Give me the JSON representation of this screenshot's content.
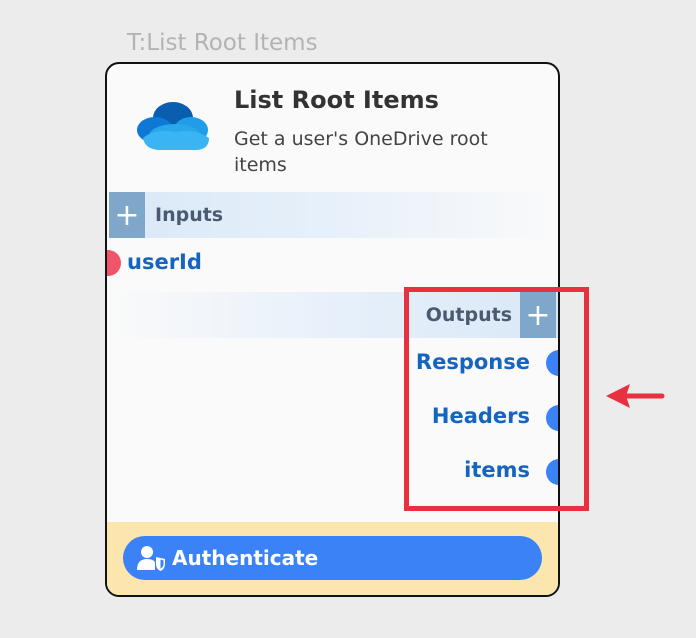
{
  "node_type_label": "T:List Root Items",
  "node": {
    "title": "List Root Items",
    "subtitle": "Get a user's OneDrive root items",
    "logo_icon": "onedrive-cloud-icon",
    "inputs": {
      "label": "Inputs",
      "add_icon": "+",
      "ports": [
        {
          "label": "userId"
        }
      ]
    },
    "outputs": {
      "label": "Outputs",
      "add_icon": "+",
      "ports": [
        {
          "label": "Response"
        },
        {
          "label": "Headers"
        },
        {
          "label": "items"
        }
      ]
    },
    "footer": {
      "authenticate_label": "Authenticate",
      "authenticate_icon": "user-shield-icon"
    }
  },
  "colors": {
    "input_port": "#f05468",
    "output_port": "#3b82f6",
    "port_label": "#1565c0",
    "auth_button": "#3b82f6",
    "footer_bg": "#fde6ad",
    "highlight": "#e8303e"
  }
}
